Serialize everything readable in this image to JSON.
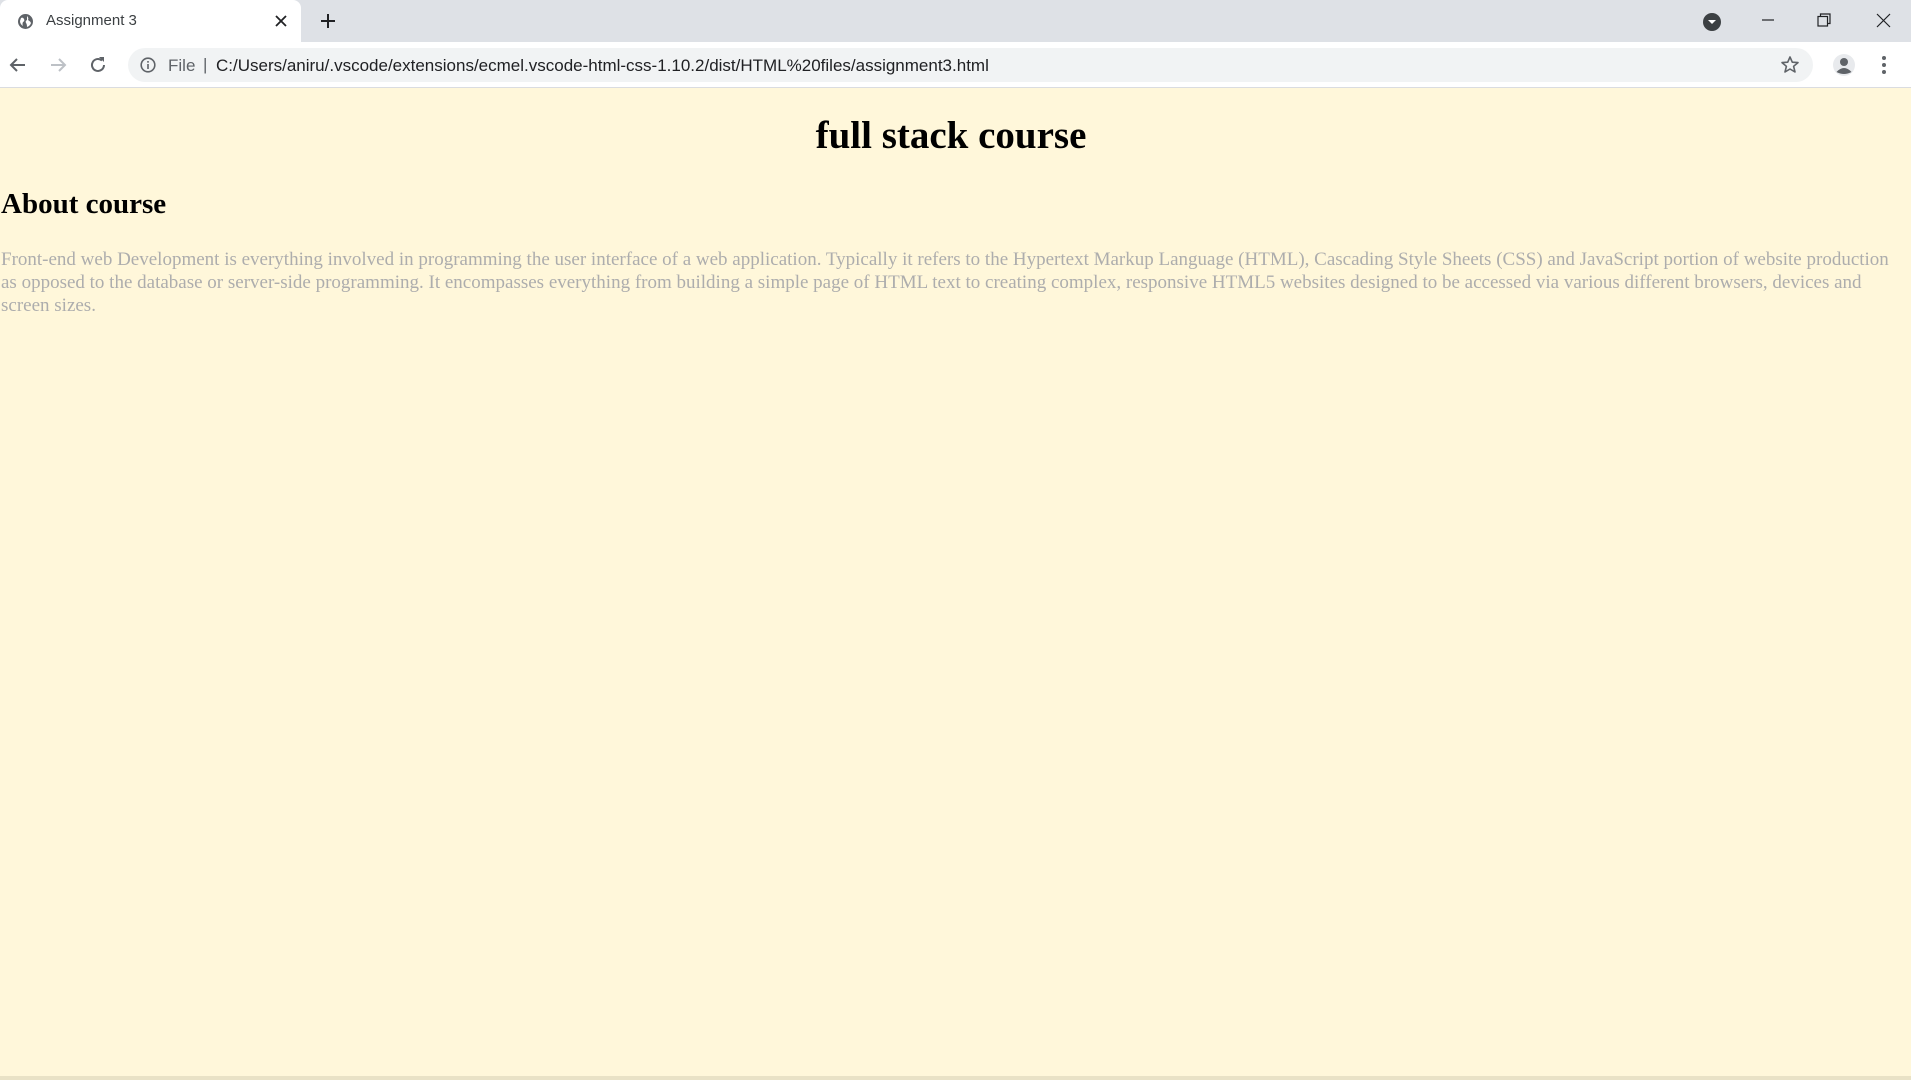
{
  "browser": {
    "tab": {
      "title": "Assignment 3",
      "favicon": "globe-icon"
    },
    "omnibox": {
      "scheme_label": "File",
      "separator": "|",
      "url": "C:/Users/aniru/.vscode/extensions/ecmel.vscode-html-css-1.10.2/dist/HTML%20files/assignment3.html"
    },
    "icons": {
      "back": "arrow-left-icon",
      "forward": "arrow-right-icon",
      "reload": "reload-icon",
      "info": "info-icon",
      "bookmark": "star-icon",
      "profile": "profile-icon",
      "menu": "kebab-menu-icon"
    }
  },
  "page": {
    "title": "full stack course",
    "section_heading": "About course",
    "body": "Front-end web Development is everything involved in programming the user interface of a web application. Typically it refers to the Hypertext Markup Language (HTML), Cascading Style Sheets (CSS) and JavaScript portion of website production as opposed to the database or server-side programming. It encompasses everything from building a simple page of HTML text to creating complex, responsive HTML5 websites designed to be accessed via various different browsers, devices and screen sizes."
  },
  "colors": {
    "page_background": "#fff7da",
    "body_text": "#adadad",
    "chrome_titlebar": "#dee1e6"
  }
}
